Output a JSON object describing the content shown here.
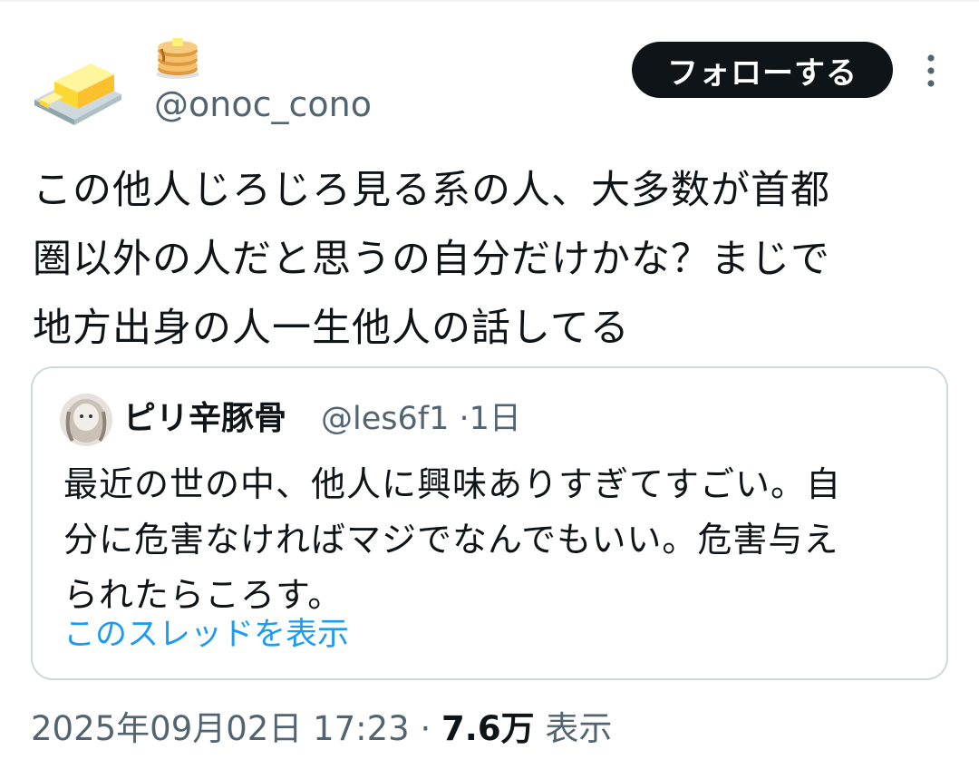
{
  "author": {
    "display_name_emoji": "pancakes-icon",
    "handle": "@onoc_cono",
    "avatar_icon": "butter-icon"
  },
  "actions": {
    "follow_label": "フォローする",
    "more_icon": "more-vertical-icon"
  },
  "tweet": {
    "text": "この他人じろじろ見る系の人、大多数が首都\n圏以外の人だと思うの自分だけかな？まじで\n地方出身の人一生他人の話してる"
  },
  "quote": {
    "display_name": "ピリ辛豚骨",
    "handle": "@les6f1",
    "separator": "·",
    "time": "1日",
    "text": "最近の世の中、他人に興味ありすぎてすごい。自\n分に危害なければマジでなんでもいい。危害与え\nられたらころす。",
    "thread_link": "このスレッドを表示"
  },
  "footer": {
    "datetime": "2025年09月02日 17:23",
    "separator": "·",
    "views_count": "7.6万",
    "views_label": "表示"
  },
  "colors": {
    "text_primary": "#0f1419",
    "text_secondary": "#536471",
    "link": "#1d9bf0",
    "border": "#cfd9de",
    "button_bg": "#0f1419"
  }
}
